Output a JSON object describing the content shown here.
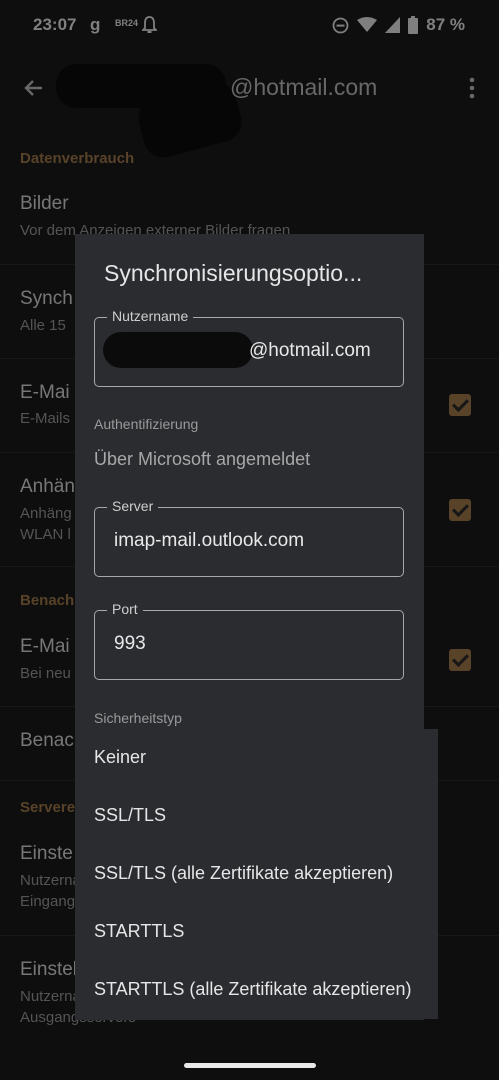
{
  "status_bar": {
    "time": "23:07",
    "battery": "87 %",
    "icons": [
      "g-icon",
      "br24-icon",
      "bell-icon",
      "dnd-icon",
      "wifi-icon",
      "signal-icon",
      "battery-icon"
    ],
    "br24": "BR24"
  },
  "appbar": {
    "title": "@hotmail.com"
  },
  "settings": {
    "section_data": "Datenverbrauch",
    "images_title": "Bilder",
    "images_sub": "Vor dem Anzeigen externer Bilder fragen",
    "sync_title": "Synch",
    "sync_sub": "Alle 15",
    "email_title": "E-Mai",
    "email_sub": "E-Mails",
    "attach_title": "Anhän",
    "attach_sub1": "Anhäng",
    "attach_sub2": "WLAN l",
    "section_notif": "Benach",
    "notif_title": "E-Mai",
    "notif_sub": "Bei neu",
    "notif2_title": "Benac",
    "section_server": "Servere",
    "incoming_title": "Einste",
    "incoming_sub1": "Nutzerna",
    "incoming_sub2": "Eingangs",
    "outgoing_title": "Einstell",
    "outgoing_sub1": "Nutzerna",
    "outgoing_sub2": "Ausgangsservers"
  },
  "dialog": {
    "title": "Synchronisierungsoptio...",
    "username_label": "Nutzername",
    "username_value": "@hotmail.com",
    "auth_label": "Authentifizierung",
    "auth_value": "Über Microsoft angemeldet",
    "server_label": "Server",
    "server_value": "imap-mail.outlook.com",
    "port_label": "Port",
    "port_value": "993",
    "security_label": "Sicherheitstyp"
  },
  "security_menu": {
    "options": [
      "Keiner",
      "SSL/TLS",
      "SSL/TLS (alle Zertifikate akzeptieren)",
      "STARTTLS",
      "STARTTLS (alle Zertifikate akzeptieren)"
    ]
  },
  "colors": {
    "accent": "#a0784a",
    "dialog_bg": "#2b2c30",
    "background": "#1a1a1a"
  }
}
